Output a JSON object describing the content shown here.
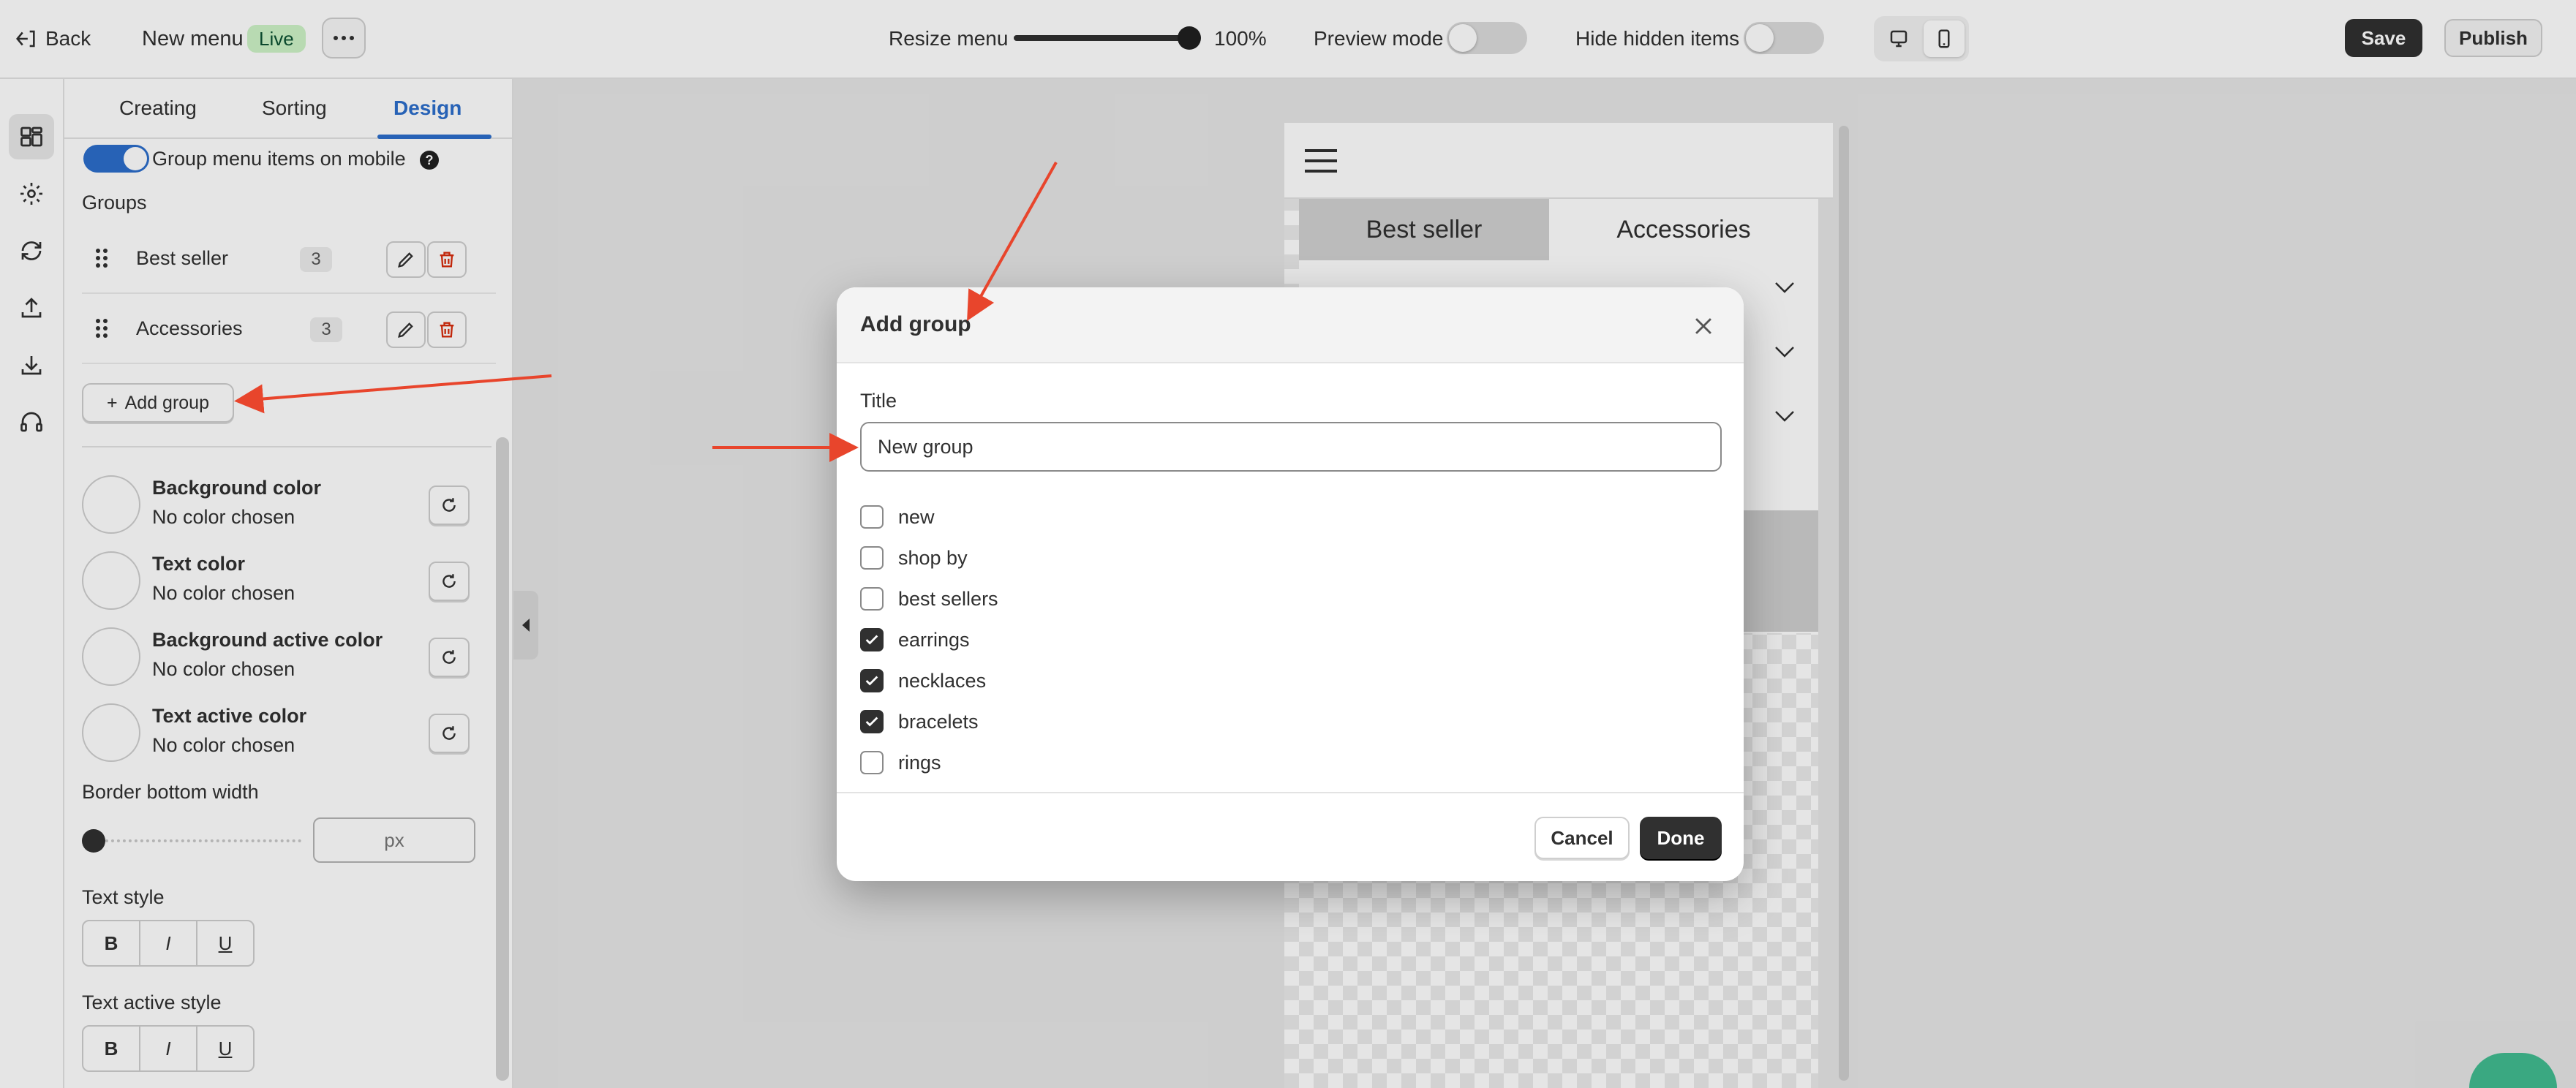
{
  "topbar": {
    "back_label": "Back",
    "menu_name": "New menu",
    "status_badge": "Live",
    "resize_label": "Resize menu",
    "zoom_value": "100%",
    "zoom_level": 1.0,
    "preview_mode_label": "Preview mode",
    "preview_mode_on": false,
    "hide_hidden_label": "Hide hidden items",
    "hide_hidden_on": false,
    "device_selected": "mobile",
    "save_label": "Save",
    "publish_label": "Publish"
  },
  "rail": {
    "icons": [
      "dashboard-icon",
      "gear-icon",
      "sync-icon",
      "upload-icon",
      "download-icon",
      "headphones-icon"
    ],
    "active": "dashboard-icon"
  },
  "panel": {
    "tabs": [
      {
        "label": "Creating"
      },
      {
        "label": "Sorting"
      },
      {
        "label": "Design"
      }
    ],
    "active_tab": "Design",
    "group_toggle_label": "Group menu items on mobile",
    "group_toggle_on": true,
    "groups_heading": "Groups",
    "groups": [
      {
        "name": "Best seller",
        "count": "3"
      },
      {
        "name": "Accessories",
        "count": "3"
      }
    ],
    "add_group_label": "Add group",
    "colors": [
      {
        "title": "Background color",
        "value": "No color chosen"
      },
      {
        "title": "Text color",
        "value": "No color chosen"
      },
      {
        "title": "Background active color",
        "value": "No color chosen"
      },
      {
        "title": "Text active color",
        "value": "No color chosen"
      }
    ],
    "border_label": "Border bottom width",
    "border_unit": "px",
    "text_style_label": "Text style",
    "text_active_style_label": "Text active style",
    "style_buttons": [
      "B",
      "I",
      "U"
    ]
  },
  "preview": {
    "tabs": [
      "Best seller",
      "Accessories"
    ],
    "active_tab": "Best seller"
  },
  "modal": {
    "title": "Add group",
    "field_label": "Title",
    "title_value": "New group",
    "items": [
      {
        "label": "new",
        "checked": false
      },
      {
        "label": "shop by",
        "checked": false
      },
      {
        "label": "best sellers",
        "checked": false
      },
      {
        "label": "earrings",
        "checked": true
      },
      {
        "label": "necklaces",
        "checked": true
      },
      {
        "label": "bracelets",
        "checked": true
      },
      {
        "label": "rings",
        "checked": false
      }
    ],
    "cancel_label": "Cancel",
    "done_label": "Done"
  },
  "colors": {
    "accent": "#2c6ecb",
    "primary_button": "#303030",
    "annotation_arrow": "#e8452c",
    "live_badge": "#cdf3c7"
  }
}
